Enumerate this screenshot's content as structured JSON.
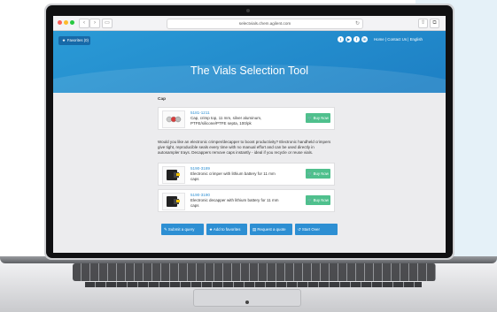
{
  "browser": {
    "url": "selectvials.chem.agilent.com",
    "reload_icon": "reload-icon"
  },
  "header": {
    "favorites_label": "Favorites (0)",
    "social_icons": [
      "twitter-icon",
      "youtube-icon",
      "facebook-icon",
      "linkedin-icon"
    ],
    "links": "Home | Contact Us | English",
    "title": "The Vials Selection Tool",
    "brand_color": "#1d7fc4"
  },
  "cap_section": {
    "label": "Cap",
    "products": [
      {
        "part_number": "5181-1211",
        "description": "Cap, crimp top, 11 mm, silver aluminum, PTFE/silicone/PTFE septa, 100/pk",
        "buy_label": "Buy Now"
      }
    ]
  },
  "promo": {
    "text": "Would you like an electronic crimper/decapper to boost productivity? Electronic handheld crimpers give tight, reproducible seals every time with no manual effort and can be used directly in autosampler trays. Decappers remove caps instantly - ideal if you recycle or reuse vials.",
    "products": [
      {
        "part_number": "5190-3189",
        "description": "Electronic crimper with lithium battery for 11 mm caps",
        "buy_label": "Buy Now"
      },
      {
        "part_number": "5190-3190",
        "description": "Electronic decapper with lithium battery for 11 mm caps",
        "buy_label": "Buy Now"
      }
    ]
  },
  "actions": {
    "submit": "Submit a query",
    "favorites": "Add to favorites",
    "quote": "Request a quote",
    "start_over": "Start Over"
  },
  "colors": {
    "accent": "#2d8fd3",
    "buy": "#4fc08d"
  }
}
